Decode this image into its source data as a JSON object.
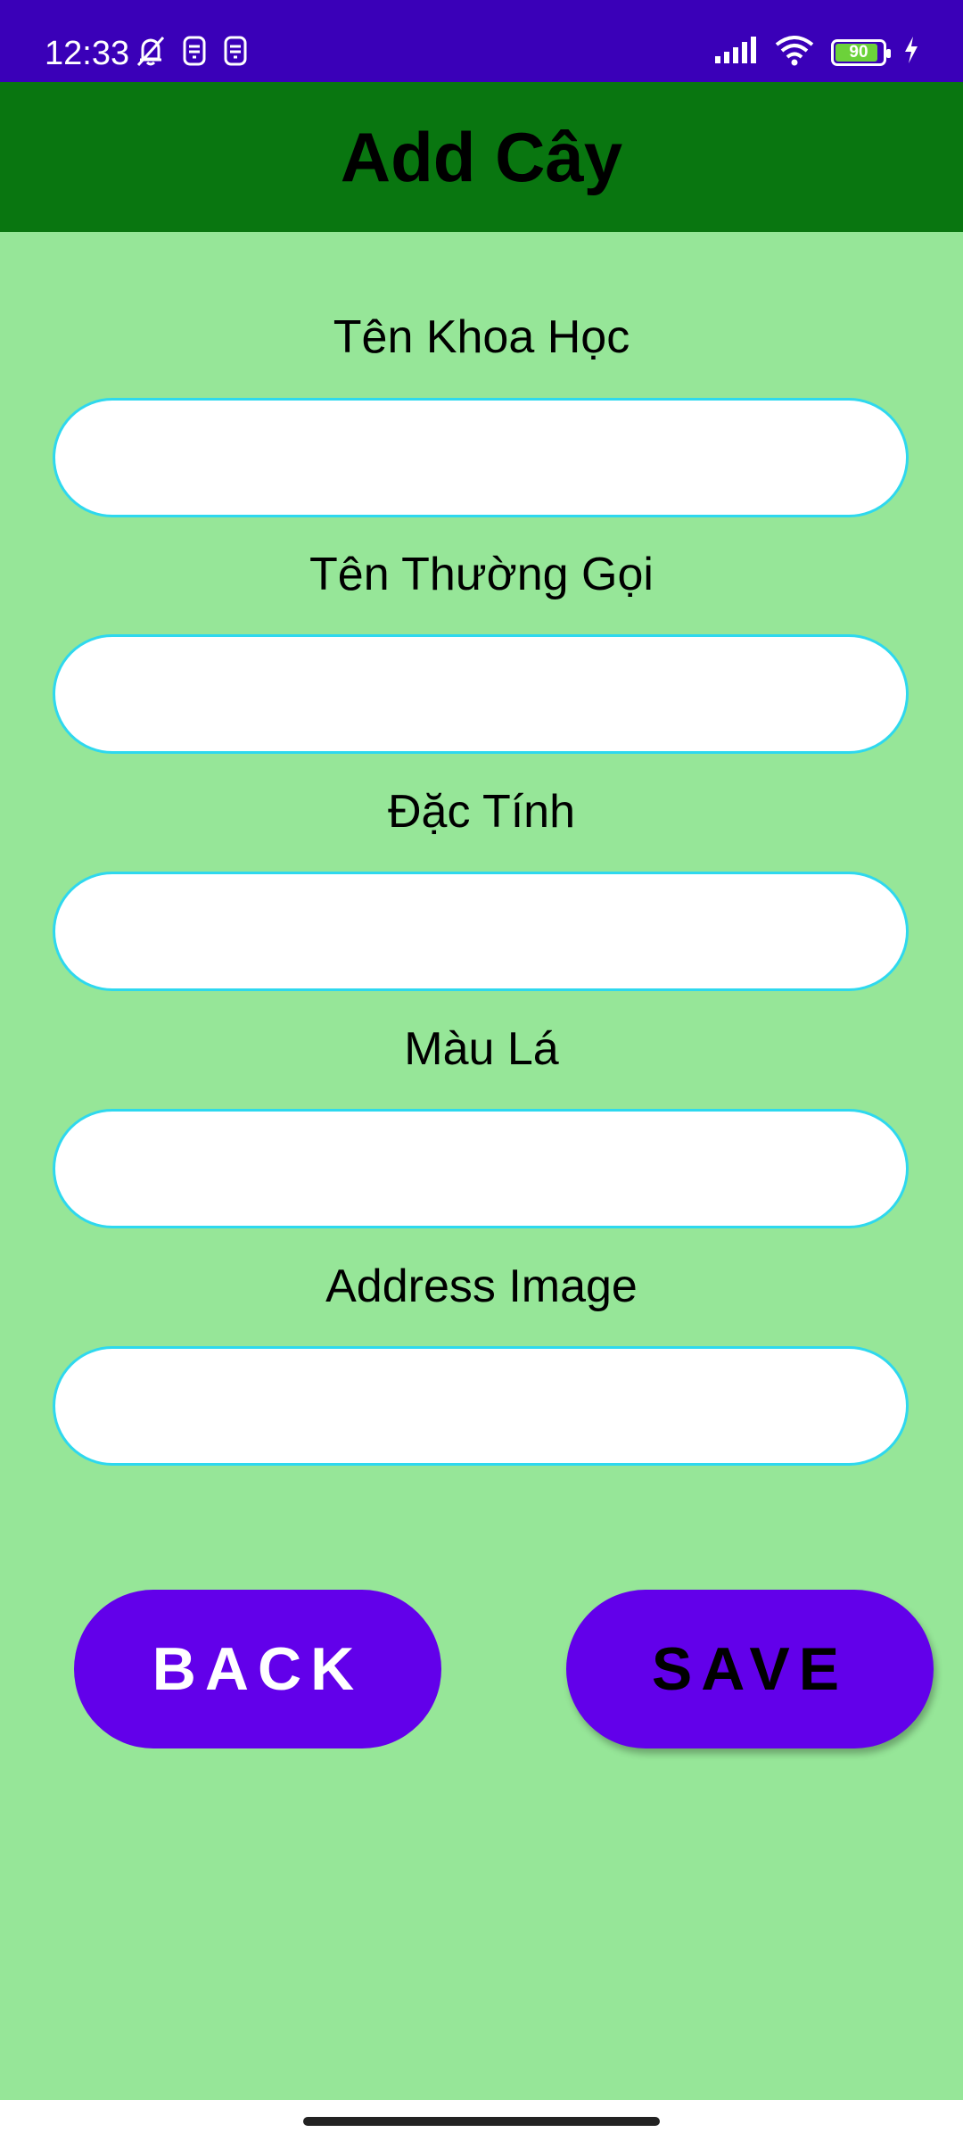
{
  "status_bar": {
    "time": "12:33",
    "battery_level": "90",
    "battery_fraction": 0.9,
    "icons": [
      "bell-off-icon",
      "sim-icon",
      "sim-icon",
      "signal-icon",
      "wifi-icon",
      "battery-icon",
      "charging-icon"
    ],
    "background": "#3a00b8"
  },
  "app_bar": {
    "title": "Add Cây",
    "background": "#097610"
  },
  "form": {
    "background": "#96e698",
    "input_border": "#2ed8ee",
    "fields": [
      {
        "label": "Tên Khoa Học",
        "value": ""
      },
      {
        "label": "Tên Thường Gọi",
        "value": ""
      },
      {
        "label": "Đặc Tính",
        "value": ""
      },
      {
        "label": "Màu Lá",
        "value": ""
      },
      {
        "label": "Address Image",
        "value": ""
      }
    ]
  },
  "buttons": {
    "back_label": "BACK",
    "save_label": "SAVE",
    "color": "#6200ea"
  }
}
